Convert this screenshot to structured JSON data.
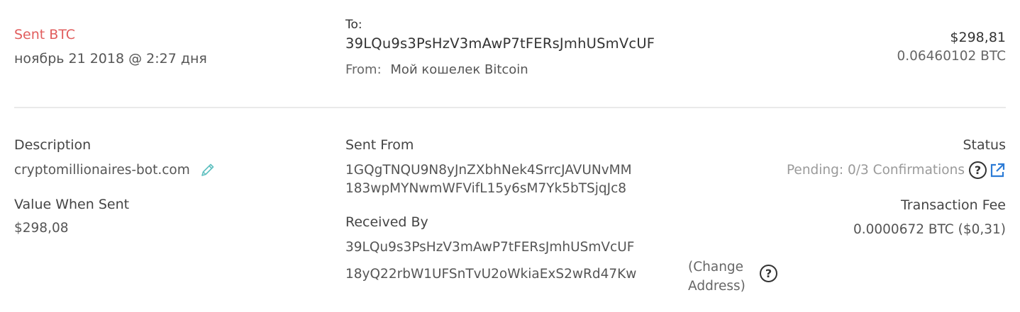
{
  "summary": {
    "type_label": "Sent BTC",
    "date": "ноябрь 21 2018 @ 2:27 дня",
    "to_label": "To:",
    "to_address": "39LQu9s3PsHzV3mAwP7tFERsJmhUSmVcUF",
    "from_label": "From:",
    "from_value": "Мой кошелек Bitcoin",
    "amount_fiat": "$298,81",
    "amount_btc": "0.06460102 BTC"
  },
  "details": {
    "description_label": "Description",
    "description_value": "cryptomillionaires-bot.com",
    "value_when_sent_label": "Value When Sent",
    "value_when_sent": "$298,08",
    "sent_from_label": "Sent From",
    "sent_from_addresses": [
      "1GQgTNQU9N8yJnZXbhNek4SrrcJAVUNvMM",
      "183wpMYNwmWFVifL15y6sM7Yk5bTSjqJc8"
    ],
    "received_by_label": "Received By",
    "received_by_addresses": [
      "39LQu9s3PsHzV3mAwP7tFERsJmhUSmVcUF",
      "18yQ22rbW1UFSnTvU2oWkiaExS2wRd47Kw"
    ],
    "change_address_note": "(Change Address)",
    "status_label": "Status",
    "status_value": "Pending: 0/3 Confirmations",
    "fee_label": "Transaction Fee",
    "fee_value": "0.0000672 BTC ($0,31)"
  },
  "icons": {
    "edit": "pencil-icon",
    "help": "question-circle-icon",
    "external": "external-link-icon"
  },
  "colors": {
    "sent_accent": "#e15d5d",
    "link_blue": "#2c7bd6",
    "pencil_teal": "#5fc0c0"
  }
}
